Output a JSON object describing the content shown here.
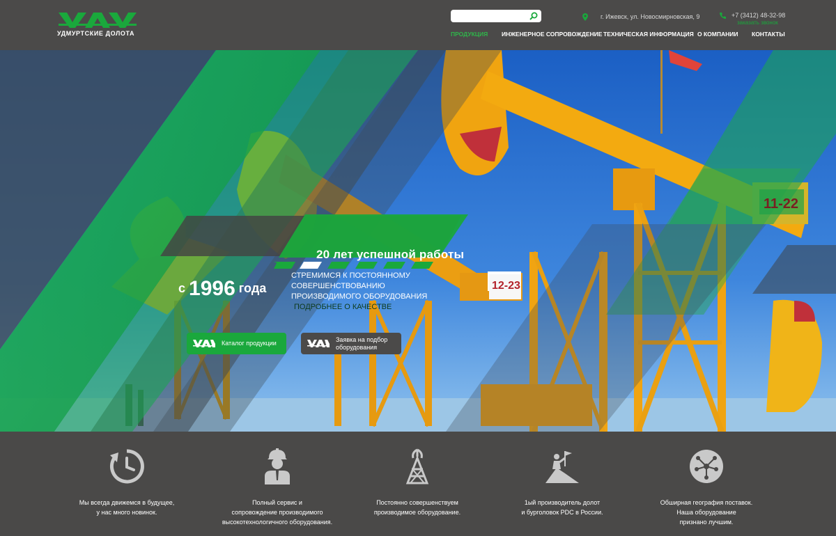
{
  "header": {
    "logo_text": "УДМУРТСКИЕ ДОЛОТА",
    "search": {
      "placeholder": "",
      "value": ""
    },
    "address": "г. Ижевск, ул. Новосмирновская, 9",
    "phone": "+7 (3412) 48-32-98",
    "callback_label": "заказать звонок",
    "nav": [
      {
        "label": "ПРОДУКЦИЯ",
        "active": true
      },
      {
        "label": "ИНЖЕНЕРНОЕ СОПРОВОЖДЕНИЕ",
        "active": false
      },
      {
        "label": "ТЕХНИЧЕСКАЯ ИНФОРМАЦИЯ",
        "active": false
      },
      {
        "label": "О КОМПАНИИ",
        "active": false
      },
      {
        "label": "КОНТАКТЫ",
        "active": false
      }
    ]
  },
  "hero": {
    "slogan": "20 лет успешной работы",
    "since_prefix": "с",
    "since_year": "1996",
    "since_suffix": "года",
    "tagline": "СТРЕМИМСЯ К ПОСТОЯННОМУ СОВЕРШЕНСТВОВАНИЮ ПРОИЗВОДИМОГО ОБОРУДОВАНИЯ",
    "quality_link": "ПОДРОБНЕЕ О КАЧЕСТВЕ",
    "slides_count": 6,
    "active_slide": 2,
    "well_number_1": "11-22",
    "well_number_2": "12-23",
    "buttons": {
      "catalog": "Каталог продукции",
      "request": "Заявка на подбор оборудования"
    }
  },
  "features": [
    {
      "icon": "clock-arrow-icon",
      "text": "Мы всегда движемся в будущее,\nу нас много новинок."
    },
    {
      "icon": "engineer-icon",
      "text": "Полный сервис и\nсопровождение производимого\nвысокотехнологичного оборудования."
    },
    {
      "icon": "oil-rig-icon",
      "text": "Постоянно совершенствуем\nпроизводимое оборудование."
    },
    {
      "icon": "summit-flag-icon",
      "text": "1ый производитель долот\nи бурголовок PDC в России."
    },
    {
      "icon": "network-icon",
      "text": "Обширная география поставок.\nНаша оборудование\nпризнано лучшим."
    }
  ],
  "colors": {
    "accent_green": "#1aa83c",
    "dark_bg": "#4a4948",
    "rig_yellow": "#f2a900"
  }
}
